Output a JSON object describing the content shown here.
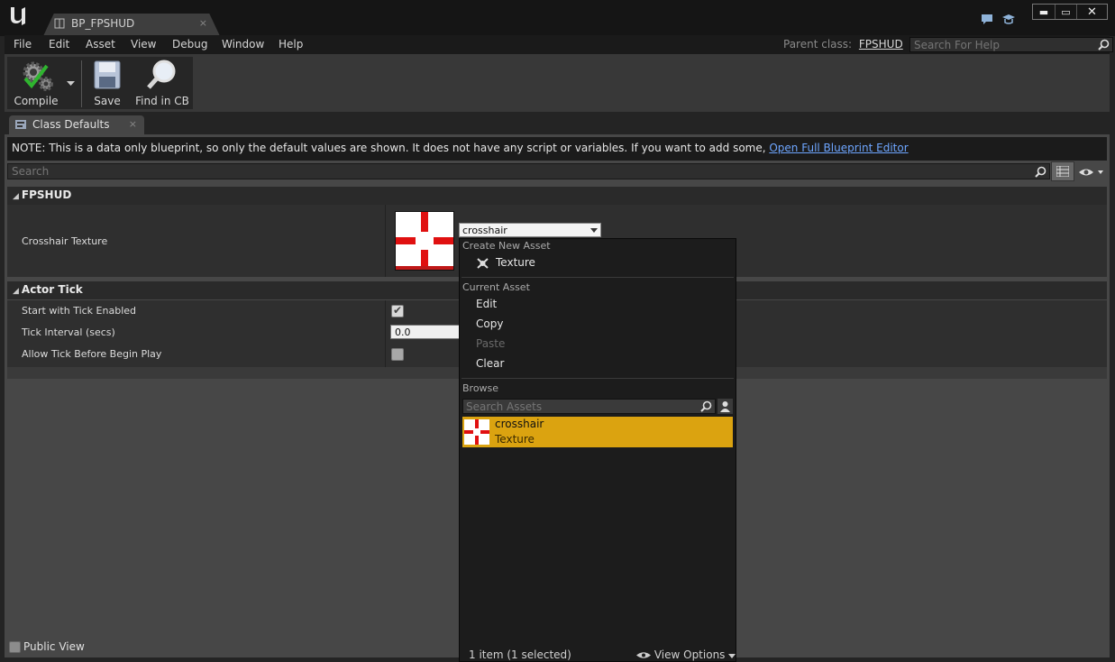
{
  "window": {
    "tab_title": "BP_FPSHUD",
    "tab_close": "×",
    "minimize": "▬",
    "maximize": "▭",
    "close": "✕"
  },
  "menu": {
    "items": [
      "File",
      "Edit",
      "Asset",
      "View",
      "Debug",
      "Window",
      "Help"
    ],
    "parent_class_label": "Parent class:",
    "parent_class_value": "FPSHUD",
    "help_search_placeholder": "Search For Help"
  },
  "toolbar": {
    "compile_label": "Compile",
    "save_label": "Save",
    "find_label": "Find in CB"
  },
  "panel_tab": {
    "label": "Class Defaults",
    "close": "×"
  },
  "note": {
    "text": "NOTE: This is a data only blueprint, so only the default values are shown.  It does not have any script or variables.  If you want to add some, ",
    "link": "Open Full Blueprint Editor"
  },
  "details": {
    "search_placeholder": "Search",
    "categories": [
      {
        "name": "FPSHUD",
        "properties": [
          {
            "label": "Crosshair Texture",
            "value": "crosshair"
          }
        ]
      },
      {
        "name": "Actor Tick",
        "properties": [
          {
            "label": "Start with Tick Enabled",
            "checked": true
          },
          {
            "label": "Tick Interval (secs)",
            "value": "0.0"
          },
          {
            "label": "Allow Tick Before Begin Play",
            "checked": false
          }
        ]
      }
    ],
    "public_view_label": "Public View"
  },
  "asset_picker": {
    "create_new_header": "Create New Asset",
    "create_texture": "Texture",
    "current_asset_header": "Current Asset",
    "actions": [
      {
        "label": "Edit",
        "enabled": true
      },
      {
        "label": "Copy",
        "enabled": true
      },
      {
        "label": "Paste",
        "enabled": false
      },
      {
        "label": "Clear",
        "enabled": true
      }
    ],
    "browse_header": "Browse",
    "search_placeholder": "Search Assets",
    "items": [
      {
        "name": "crosshair",
        "type": "Texture",
        "selected": true
      }
    ],
    "footer_count": "1 item (1 selected)",
    "view_options": "View Options"
  },
  "colors": {
    "selection": "#dba310",
    "link": "#6ea6ff",
    "crosshair_red": "#e01010"
  }
}
